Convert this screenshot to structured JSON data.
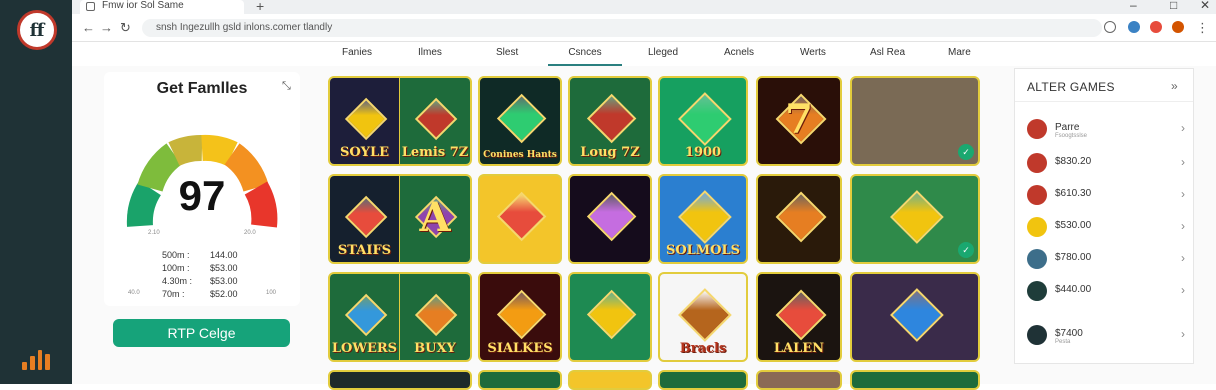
{
  "browser": {
    "tab_title": "Fmw ior Sol Same",
    "new_tab": "+",
    "url": "snsh Ingezullh gsld inlons.comer tlandly",
    "window_controls": [
      "–",
      "□",
      "✕"
    ]
  },
  "logo_text": "ff",
  "nav": {
    "items": [
      "Fanies",
      "Ilmes",
      "Slest",
      "Csnces",
      "Lleged",
      "Acnels",
      "Werts",
      "Asl Rea",
      "Mare"
    ],
    "active_index": 3
  },
  "gauge_card": {
    "title": "Get Famlles",
    "close": "⤡",
    "value": "97",
    "stats": [
      {
        "left": "500m :",
        "right": "144.00"
      },
      {
        "left": "100m :",
        "right": "$53.00"
      },
      {
        "left": "4.30m :",
        "right": "$53.00"
      },
      {
        "left": "70m :",
        "right": "$52.00"
      }
    ],
    "tick_left": "2.10",
    "tick_right": "20.0",
    "tick_bl": "40.0",
    "tick_br": "100"
  },
  "rtp_button": "RTP Celge",
  "games": [
    {
      "label": "SOYLE",
      "bg": "#1d1e3a",
      "gem": "#f1c40f"
    },
    {
      "label": "Lemis 7Z",
      "bg": "#1e6b3b",
      "gem": "#c0392b"
    },
    {
      "label": "Conines Hants",
      "bg": "#0f2a26",
      "gem": "#2ecc71"
    },
    {
      "label": "Loug 7Z",
      "bg": "#1e6b3b",
      "gem": "#c0392b"
    },
    {
      "label": "1900",
      "bg": "#16a060",
      "gem": "#2ecc71"
    },
    {
      "label": "7",
      "bg": "#2a0f08",
      "gem": "#e67e22"
    },
    {
      "label": "",
      "bg": "#7a6a55",
      "gem": ""
    },
    {
      "label": "STAIFS",
      "bg": "#15202e",
      "gem": "#e74c3c"
    },
    {
      "label": "A",
      "bg": "#1e6b3b",
      "gem": "#8e44ad"
    },
    {
      "label": "",
      "bg": "#f3c52a",
      "gem": "#e74c3c"
    },
    {
      "label": "",
      "bg": "#150c1c",
      "gem": "#c56de0"
    },
    {
      "label": "SOLMOLS",
      "bg": "#2b7fd0",
      "gem": "#f1c40f"
    },
    {
      "label": "",
      "bg": "#2a1a0a",
      "gem": "#e67e22"
    },
    {
      "label": "",
      "bg": "#2f8a4a",
      "gem": "#f1c40f"
    },
    {
      "label": "LOWERS",
      "bg": "#1e6b3b",
      "gem": "#3498db"
    },
    {
      "label": "BUXY",
      "bg": "#1e6b3b",
      "gem": "#e67e22"
    },
    {
      "label": "SIALKES",
      "bg": "#3a0c0c",
      "gem": "#f39c12"
    },
    {
      "label": "",
      "bg": "#1e8a52",
      "gem": "#f1c40f"
    },
    {
      "label": "Bracls",
      "bg": "#f6f6f6",
      "gem": "#b5651d"
    },
    {
      "label": "LALEN",
      "bg": "#1b1410",
      "gem": "#e74c3c"
    },
    {
      "label": "",
      "bg": "#3a2b4a",
      "gem": "#2e86de"
    }
  ],
  "right_panel": {
    "title": "ALTER GAMES",
    "expand": "»",
    "items": [
      {
        "value": "Parre",
        "sub": "Fsoogtsslse",
        "color": "#c0392b"
      },
      {
        "value": "$830.20",
        "sub": "",
        "color": "#c0392b"
      },
      {
        "value": "$610.30",
        "sub": "",
        "color": "#c0392b"
      },
      {
        "value": "$530.00",
        "sub": "",
        "color": "#f1c40f"
      },
      {
        "value": "$780.00",
        "sub": "",
        "color": "#3d6e8a"
      },
      {
        "value": "$440.00",
        "sub": "",
        "color": "#1f3d3a"
      },
      {
        "value": "$7400",
        "sub": "Pesta",
        "color": "#1f3236"
      }
    ]
  }
}
